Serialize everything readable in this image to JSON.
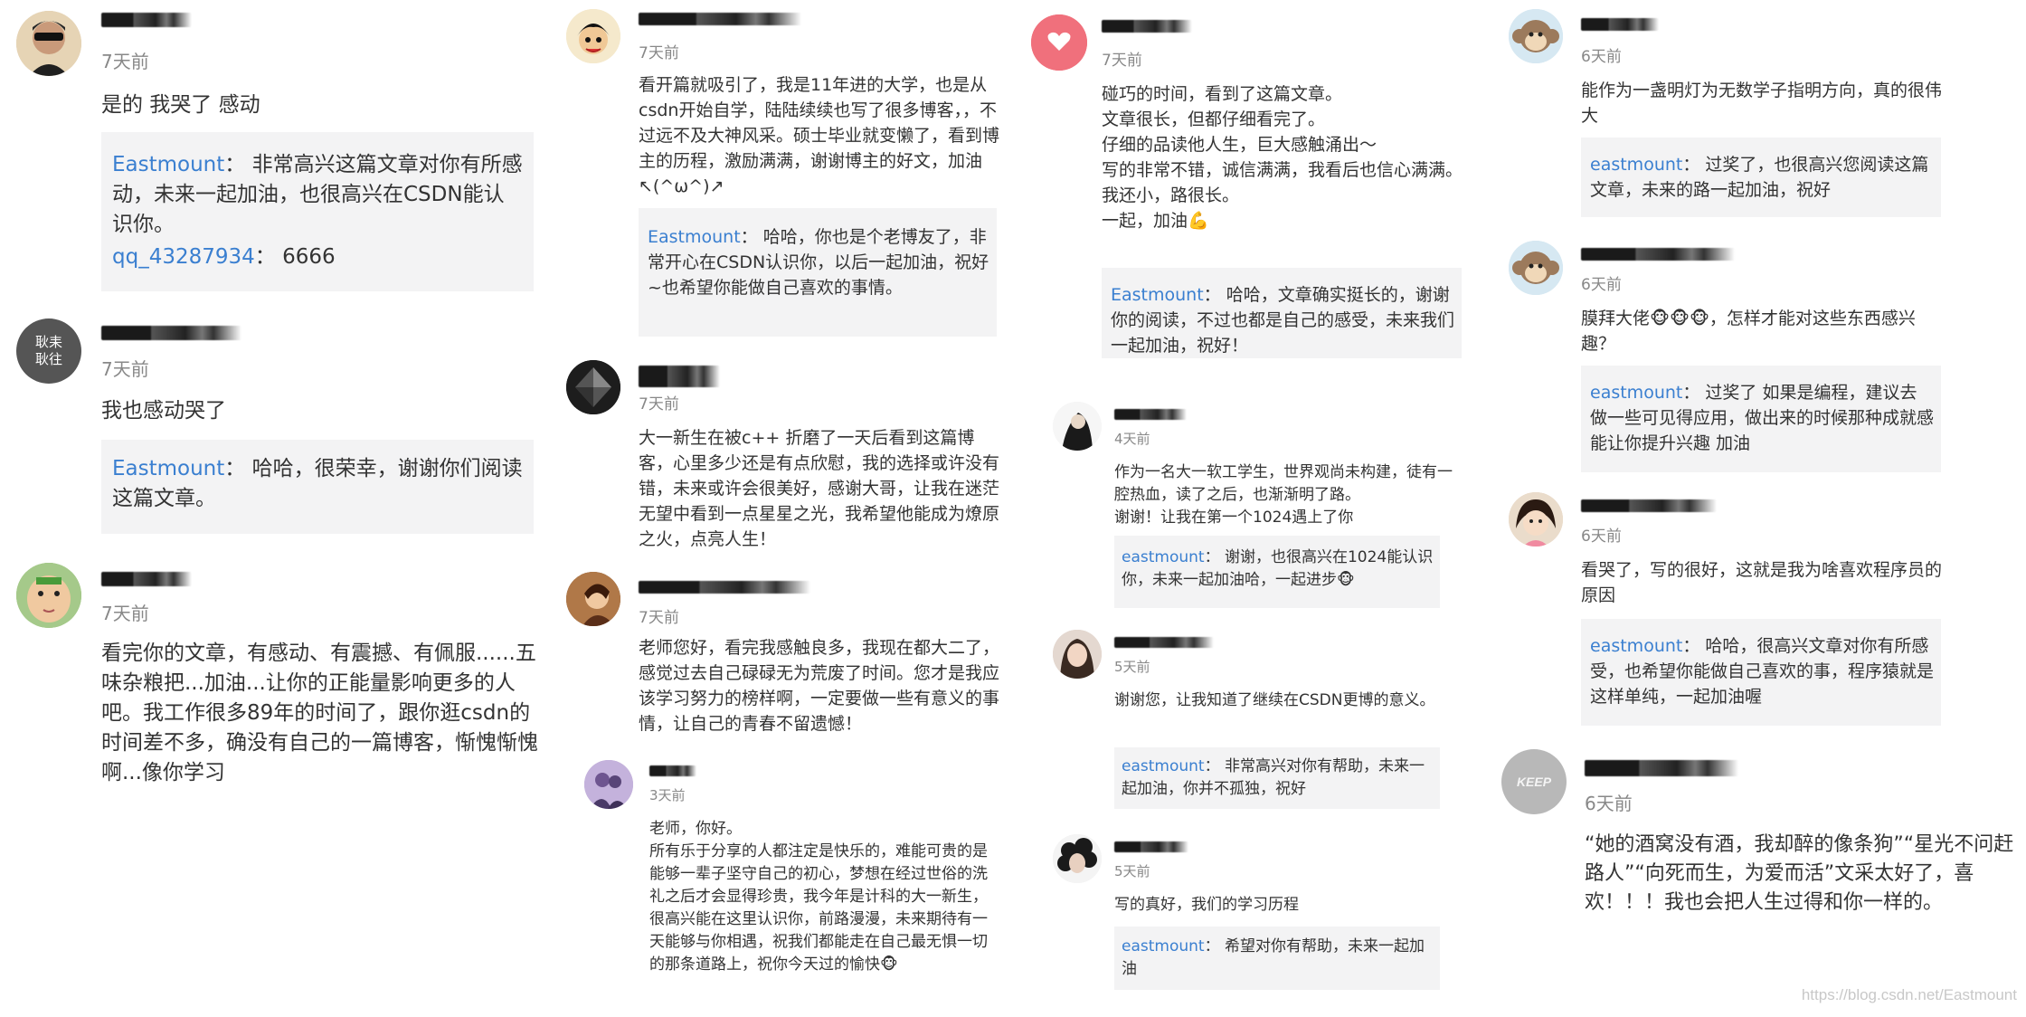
{
  "colors": {
    "reply_user": "#3a7fd0",
    "reply_bg": "#f3f3f4",
    "time": "#888888"
  },
  "columns": [
    {
      "comments": [
        {
          "avatar_icon": "sunglasses-person-avatar",
          "time": "7天前",
          "body": "是的 我哭了 感动",
          "reply_user": "Eastmount",
          "reply_sep": "：",
          "reply_text": " 非常高兴这篇文章对你有所感动，未来一起加油，也很高兴在CSDN能认识你。",
          "reply2_user": "qq_43287934",
          "reply2_sep": "：",
          "reply2_text": " 6666"
        },
        {
          "avatar_icon": "chinese-seal-avatar",
          "avatar_text": "耿耒耿往",
          "time": "7天前",
          "body": "我也感动哭了",
          "reply_user": "Eastmount",
          "reply_sep": "：",
          "reply_text": " 哈哈，很荣幸，谢谢你们阅读这篇文章。"
        },
        {
          "avatar_icon": "baby-face-avatar",
          "time": "7天前",
          "body": "看完你的文章，有感动、有震撼、有佩服......五味杂粮把...加油...让你的正能量影响更多的人吧。我工作很多89年的时间了，跟你逛csdn的时间差不多，确没有自己的一篇博客，惭愧惭愧啊...像你学习"
        }
      ]
    },
    {
      "comments": [
        {
          "avatar_icon": "anime-character-avatar",
          "time": "7天前",
          "body": "看开篇就吸引了，我是11年进的大学，也是从csdn开始自学，陆陆续续也写了很多博客，，不过远不及大神风采。硕士毕业就变懒了，看到博主的历程，激励满满，谢谢博主的好文，加油↖(^ω^)↗",
          "reply_user": "Eastmount",
          "reply_sep": "：",
          "reply_text": " 哈哈，你也是个老博友了，非常开心在CSDN认识你，以后一起加油，祝好~也希望你能做自己喜欢的事情。"
        },
        {
          "avatar_icon": "dark-crystal-avatar",
          "time": "7天前",
          "body": "大一新生在被c++ 折磨了一天后看到这篇博客，心里多少还是有点欣慰，我的选择或许没有错，未来或许会很美好，感谢大哥，让我在迷茫无望中看到一点星星之光，我希望他能成为燎原之火，点亮人生！"
        },
        {
          "avatar_icon": "warm-portrait-avatar",
          "time": "7天前",
          "body": "老师您好，看完我感触良多，我现在都大二了，感觉过去自己碌碌无为荒废了时间。您才是我应该学习努力的榜样啊，一定要做一些有意义的事情，让自己的青春不留遗憾！"
        },
        {
          "avatar_icon": "purple-couple-avatar",
          "time": "3天前",
          "body": "老师，你好。\n所有乐于分享的人都注定是快乐的，难能可贵的是能够一辈子坚守自己的初心，梦想在经过世俗的洗礼之后才会显得珍贵，我今年是计科的大一新生，很高兴能在这里认识你，前路漫漫，未来期待有一天能够与你相遇，祝我们都能走在自己最无惧一切的那条道路上，祝你今天过的愉快🐵"
        }
      ]
    },
    {
      "comments": [
        {
          "avatar_icon": "pink-heart-avatar",
          "time": "7天前",
          "body": "碰巧的时间，看到了这篇文章。\n文章很长，但都仔细看完了。\n仔细的品读他人生，巨大感触涌出～\n写的非常不错，诚信满满，我看后也信心满满。\n我还小，路很长。\n一起，加油💪",
          "reply_user": "Eastmount",
          "reply_sep": "：",
          "reply_text": " 哈哈，文章确实挺长的，谢谢你的阅读，不过也都是自己的感受，未来我们一起加油，祝好！"
        },
        {
          "avatar_icon": "ink-figure-avatar",
          "time": "4天前",
          "body": "作为一名大一软工学生，世界观尚未构建，徒有一腔热血，读了之后，也渐渐明了路。\n谢谢！让我在第一个1024遇上了你",
          "reply_user": "eastmount",
          "reply_sep": "：",
          "reply_text": " 谢谢，也很高兴在1024能认识你，未来一起加油哈，一起进步🐵"
        },
        {
          "avatar_icon": "girl-portrait-avatar",
          "time": "5天前",
          "body": "谢谢您，让我知道了继续在CSDN更博的意义。",
          "reply_user": "eastmount",
          "reply_sep": "：",
          "reply_text": " 非常高兴对你有帮助，未来一起加油，你并不孤独，祝好"
        },
        {
          "avatar_icon": "curly-hair-avatar",
          "time": "5天前",
          "body": "写的真好，我们的学习历程",
          "reply_user": "eastmount",
          "reply_sep": "：",
          "reply_text": " 希望对你有帮助，未来一起加油"
        }
      ]
    },
    {
      "comments": [
        {
          "avatar_icon": "monkey-avatar",
          "time": "6天前",
          "body": "能作为一盏明灯为无数学子指明方向，真的很伟大",
          "reply_user": "eastmount",
          "reply_sep": "：",
          "reply_text": " 过奖了，也很高兴您阅读这篇文章，未来的路一起加油，祝好"
        },
        {
          "avatar_icon": "monkey-avatar",
          "time": "6天前",
          "body": "膜拜大佬🐵🐵🐵，怎样才能对这些东西感兴趣？",
          "reply_user": "eastmount",
          "reply_sep": "：",
          "reply_text": " 过奖了 如果是编程，建议去做一些可见得应用，做出来的时候那种成就感能让你提升兴趣 加油"
        },
        {
          "avatar_icon": "child-photo-avatar",
          "time": "6天前",
          "body": "看哭了，写的很好，这就是我为啥喜欢程序员的原因",
          "reply_user": "eastmount",
          "reply_sep": "：",
          "reply_text": " 哈哈，很高兴文章对你有所感受，也希望你能做自己喜欢的事，程序猿就是这样单纯，一起加油喔"
        },
        {
          "avatar_icon": "keep-shirt-avatar",
          "avatar_text": "KEEP",
          "time": "6天前",
          "body": "“她的酒窝没有酒，我却醉的像条狗”“星光不问赶路人”“向死而生，为爱而活”文采太好了，喜欢！！！我也会把人生过得和你一样的。"
        }
      ]
    }
  ],
  "watermark": "https://blog.csdn.net/Eastmount"
}
